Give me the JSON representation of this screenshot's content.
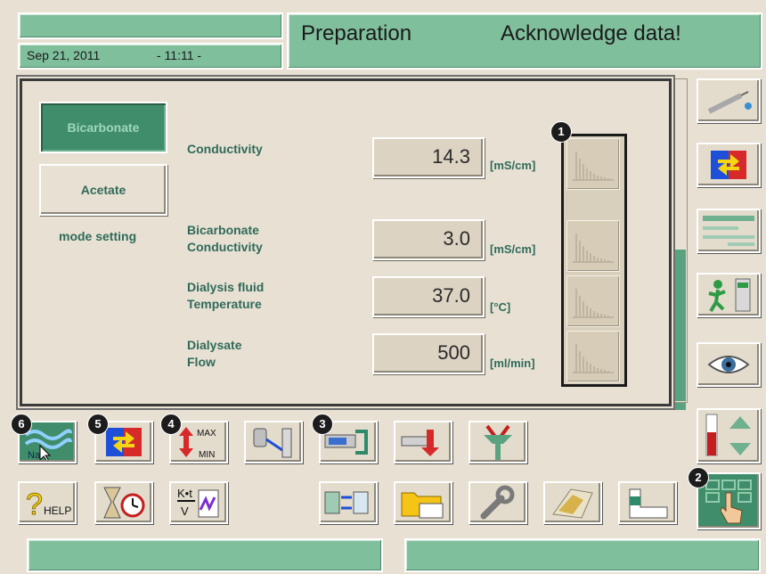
{
  "header": {
    "date": "Sep 21, 2011",
    "time": "- 11:11 -",
    "mode_title": "Preparation",
    "message": "Acknowledge data!"
  },
  "modes": {
    "bicarbonate_label": "Bicarbonate",
    "acetate_label": "Acetate",
    "caption": "mode setting"
  },
  "params": [
    {
      "label_line1": "Conductivity",
      "label_line2": "",
      "value": "14.3",
      "unit": "[mS/cm]"
    },
    {
      "label_line1": "Bicarbonate",
      "label_line2": "Conductivity",
      "value": "3.0",
      "unit": "[mS/cm]"
    },
    {
      "label_line1": "Dialysis fluid",
      "label_line2": "Temperature",
      "value": "37.0",
      "unit": "[°C]"
    },
    {
      "label_line1": "Dialysate",
      "label_line2": "Flow",
      "value": "500",
      "unit": "[ml/min]"
    }
  ],
  "badges": {
    "b1": "1",
    "b2": "2",
    "b3": "3",
    "b4": "4",
    "b5": "5",
    "b6": "6"
  },
  "toolbar": {
    "max_label": "MAX",
    "min_label": "MIN",
    "help_label": "HELP",
    "kt_label_top": "K•t",
    "kt_label_bottom": "V",
    "na_label": "Na"
  },
  "colors": {
    "panel_green": "#7fbf9c",
    "active_green": "#3f8d6b",
    "label_text": "#2f6a5a",
    "background": "#e8e1d3"
  }
}
